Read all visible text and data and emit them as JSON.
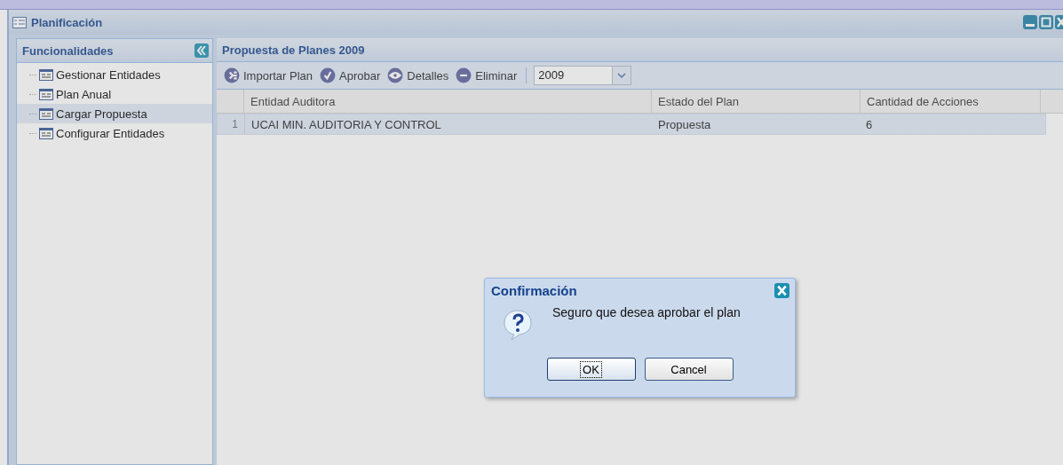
{
  "window": {
    "title": "Planificación"
  },
  "sidebar": {
    "title": "Funcionalidades",
    "items": [
      {
        "label": "Gestionar Entidades",
        "selected": false
      },
      {
        "label": "Plan Anual",
        "selected": false
      },
      {
        "label": "Cargar Propuesta",
        "selected": true
      },
      {
        "label": "Configurar Entidades",
        "selected": false
      }
    ]
  },
  "panel": {
    "title": "Propuesta de Planes 2009",
    "toolbar": [
      {
        "kind": "import",
        "label": "Importar Plan"
      },
      {
        "kind": "approve",
        "label": "Aprobar"
      },
      {
        "kind": "details",
        "label": "Detalles"
      },
      {
        "kind": "delete",
        "label": "Eliminar"
      }
    ],
    "year_select": {
      "value": "2009"
    },
    "table": {
      "columns": [
        "Entidad Auditora",
        "Estado del Plan",
        "Cantidad de Acciones"
      ],
      "rows": [
        {
          "number": "1",
          "cells": [
            "UCAI MIN. AUDITORIA Y CONTROL",
            "Propuesta",
            "6"
          ],
          "selected": true
        }
      ]
    }
  },
  "dialog": {
    "title": "Confirmación",
    "message": "Seguro que desea aprobar el plan",
    "buttons": [
      {
        "label": "OK",
        "focused": true
      },
      {
        "label": "Cancel",
        "focused": false
      }
    ]
  }
}
